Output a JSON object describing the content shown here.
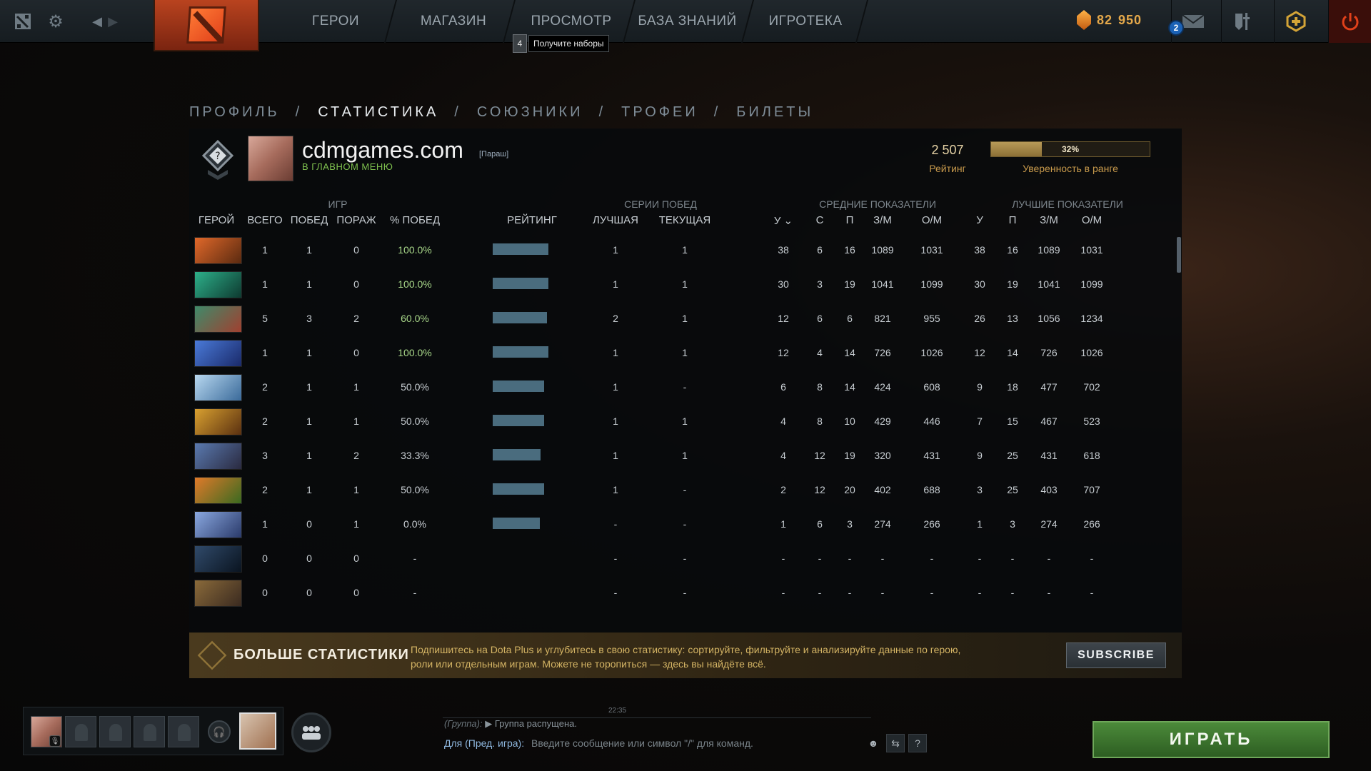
{
  "topbar": {
    "nav": [
      "ГЕРОИ",
      "МАГАЗИН",
      "ПРОСМОТР",
      "БАЗА ЗНАНИЙ",
      "ИГРОТЕКА"
    ],
    "tooltip_num": "4",
    "tooltip_text": "Получите наборы",
    "currency_main": "82",
    "currency_sub": "950",
    "notif_count": "2",
    "accent": "#e0401a"
  },
  "breadcrumb": {
    "items": [
      "ПРОФИЛЬ",
      "СТАТИСТИКА",
      "СОЮЗНИКИ",
      "ТРОФЕИ",
      "БИЛЕТЫ"
    ],
    "active": "СТАТИСТИКА",
    "sep": "/"
  },
  "profile": {
    "name": "cdmgames.com",
    "tag": "[Параш]",
    "status": "В ГЛАВНОМ МЕНЮ",
    "rating_value": "2 507",
    "rating_label": "Рейтинг",
    "confidence_pct": 32,
    "confidence_text": "32%",
    "confidence_label": "Уверенность в ранге"
  },
  "table": {
    "groups": {
      "games": "ИГР",
      "streaks": "СЕРИИ ПОБЕД",
      "avg": "СРЕДНИЕ ПОКАЗАТЕЛИ",
      "best": "ЛУЧШИЕ ПОКАЗАТЕЛИ"
    },
    "headers": [
      "ГЕРОЙ",
      "ВСЕГО",
      "ПОБЕД",
      "ПОРАЖ",
      "% ПОБЕД",
      "РЕЙТИНГ",
      "ЛУЧШАЯ",
      "ТЕКУЩАЯ",
      "У ⌄",
      "С",
      "П",
      "З/М",
      "О/М",
      "У",
      "П",
      "З/М",
      "О/М"
    ],
    "rows": [
      {
        "hero": "hero-1",
        "colors": [
          "#e0682a",
          "#5a2a10"
        ],
        "total": "1",
        "wins": "1",
        "losses": "0",
        "winrate": "100.0%",
        "rating_fill": 1.0,
        "best": "1",
        "current": "1",
        "k": "38",
        "d": "6",
        "a": "16",
        "gpm": "1089",
        "xpm": "1031",
        "bk": "38",
        "ba": "16",
        "bgpm": "1089",
        "bxpm": "1031",
        "winclass": true
      },
      {
        "hero": "hero-2",
        "colors": [
          "#2db08a",
          "#0e3a30"
        ],
        "total": "1",
        "wins": "1",
        "losses": "0",
        "winrate": "100.0%",
        "rating_fill": 1.0,
        "best": "1",
        "current": "1",
        "k": "30",
        "d": "3",
        "a": "19",
        "gpm": "1041",
        "xpm": "1099",
        "bk": "30",
        "ba": "19",
        "bgpm": "1041",
        "bxpm": "1099",
        "winclass": true
      },
      {
        "hero": "hero-3",
        "colors": [
          "#3f8a6a",
          "#a04030"
        ],
        "total": "5",
        "wins": "3",
        "losses": "2",
        "winrate": "60.0%",
        "rating_fill": 0.98,
        "best": "2",
        "current": "1",
        "k": "12",
        "d": "6",
        "a": "6",
        "gpm": "821",
        "xpm": "955",
        "bk": "26",
        "ba": "13",
        "bgpm": "1056",
        "bxpm": "1234",
        "winclass": true
      },
      {
        "hero": "hero-4",
        "colors": [
          "#4a7ad8",
          "#1a2a6a"
        ],
        "total": "1",
        "wins": "1",
        "losses": "0",
        "winrate": "100.0%",
        "rating_fill": 1.0,
        "best": "1",
        "current": "1",
        "k": "12",
        "d": "4",
        "a": "14",
        "gpm": "726",
        "xpm": "1026",
        "bk": "12",
        "ba": "14",
        "bgpm": "726",
        "bxpm": "1026",
        "winclass": true
      },
      {
        "hero": "hero-5",
        "colors": [
          "#b8d8f0",
          "#3a6a9a"
        ],
        "total": "2",
        "wins": "1",
        "losses": "1",
        "winrate": "50.0%",
        "rating_fill": 0.92,
        "best": "1",
        "current": "-",
        "k": "6",
        "d": "8",
        "a": "14",
        "gpm": "424",
        "xpm": "608",
        "bk": "9",
        "ba": "18",
        "bgpm": "477",
        "bxpm": "702",
        "winclass": false
      },
      {
        "hero": "hero-6",
        "colors": [
          "#d8a030",
          "#5a3010"
        ],
        "total": "2",
        "wins": "1",
        "losses": "1",
        "winrate": "50.0%",
        "rating_fill": 0.92,
        "best": "1",
        "current": "1",
        "k": "4",
        "d": "8",
        "a": "10",
        "gpm": "429",
        "xpm": "446",
        "bk": "7",
        "ba": "15",
        "bgpm": "467",
        "bxpm": "523",
        "winclass": false
      },
      {
        "hero": "hero-7",
        "colors": [
          "#5a7ab0",
          "#2a2a40"
        ],
        "total": "3",
        "wins": "1",
        "losses": "2",
        "winrate": "33.3%",
        "rating_fill": 0.86,
        "best": "1",
        "current": "1",
        "k": "4",
        "d": "12",
        "a": "19",
        "gpm": "320",
        "xpm": "431",
        "bk": "9",
        "ba": "25",
        "bgpm": "431",
        "bxpm": "618",
        "winclass": false
      },
      {
        "hero": "hero-8",
        "colors": [
          "#e07a2a",
          "#3a6a20"
        ],
        "total": "2",
        "wins": "1",
        "losses": "1",
        "winrate": "50.0%",
        "rating_fill": 0.92,
        "best": "1",
        "current": "-",
        "k": "2",
        "d": "12",
        "a": "20",
        "gpm": "402",
        "xpm": "688",
        "bk": "3",
        "ba": "25",
        "bgpm": "403",
        "bxpm": "707",
        "winclass": false
      },
      {
        "hero": "hero-9",
        "colors": [
          "#8aa8e0",
          "#2a3a6a"
        ],
        "total": "1",
        "wins": "0",
        "losses": "1",
        "winrate": "0.0%",
        "rating_fill": 0.85,
        "best": "-",
        "current": "-",
        "k": "1",
        "d": "6",
        "a": "3",
        "gpm": "274",
        "xpm": "266",
        "bk": "1",
        "ba": "3",
        "bgpm": "274",
        "bxpm": "266",
        "winclass": false
      },
      {
        "hero": "hero-10",
        "colors": [
          "#304a6a",
          "#0a1420"
        ],
        "total": "0",
        "wins": "0",
        "losses": "0",
        "winrate": "-",
        "rating_fill": 0,
        "best": "-",
        "current": "-",
        "k": "-",
        "d": "-",
        "a": "-",
        "gpm": "-",
        "xpm": "-",
        "bk": "-",
        "ba": "-",
        "bgpm": "-",
        "bxpm": "-",
        "winclass": false
      },
      {
        "hero": "hero-11",
        "colors": [
          "#8a6a3a",
          "#3a2a20"
        ],
        "total": "0",
        "wins": "0",
        "losses": "0",
        "winrate": "-",
        "rating_fill": 0,
        "best": "-",
        "current": "-",
        "k": "-",
        "d": "-",
        "a": "-",
        "gpm": "-",
        "xpm": "-",
        "bk": "-",
        "ba": "-",
        "bgpm": "-",
        "bxpm": "-",
        "winclass": false
      },
      {
        "hero": "hero-12",
        "colors": [
          "#3a5ab0",
          "#1a2a50"
        ],
        "total": "-",
        "wins": "-",
        "losses": "-",
        "winrate": "",
        "rating_fill": 0,
        "best": "",
        "current": "",
        "k": "",
        "d": "",
        "a": "",
        "gpm": "",
        "xpm": "",
        "bk": "",
        "ba": "",
        "bgpm": "",
        "bxpm": "",
        "winclass": false
      }
    ]
  },
  "plus_banner": {
    "title": "БОЛЬШЕ СТАТИСТИКИ",
    "text": "Подпишитесь на Dota Plus и углубитесь в свою статистику: сортируйте, фильтруйте и анализируйте данные по герою, роли или отдельным играм. Можете не торопиться — здесь вы найдёте всё.",
    "button": "SUBSCRIBE"
  },
  "chat": {
    "time": "22:35",
    "group_tag": "(Группа):",
    "message": "Группа распущена.",
    "to_label": "Для (Пред. игра):",
    "placeholder": "Введите сообщение или символ \"/\" для команд."
  },
  "play_button": "ИГРАТЬ"
}
